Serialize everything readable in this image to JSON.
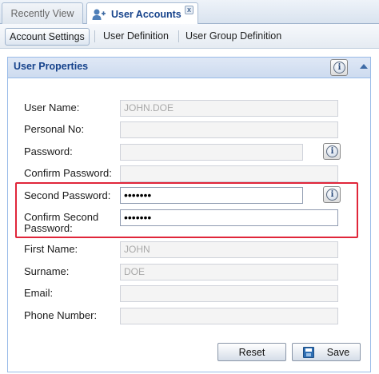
{
  "tabs": {
    "recent_label": "Recently View",
    "accounts_label": "User Accounts",
    "close_glyph": "x"
  },
  "subtabs": {
    "account_settings": "Account Settings",
    "user_definition": "User Definition",
    "user_group_definition": "User Group Definition"
  },
  "panel": {
    "title": "User Properties",
    "info_glyph": "i"
  },
  "form": {
    "user_name": {
      "label": "User Name:",
      "value": "JOHN.DOE"
    },
    "personal_no": {
      "label": "Personal No:",
      "value": ""
    },
    "password": {
      "label": "Password:",
      "value": ""
    },
    "confirm_password": {
      "label": "Confirm Password:",
      "value": ""
    },
    "second_password": {
      "label": "Second Password:",
      "value": "•••••••"
    },
    "confirm_second_password": {
      "label_line1": "Confirm Second",
      "label_line2": "Password:",
      "value": "•••••••"
    },
    "first_name": {
      "label": "First Name:",
      "value": "JOHN"
    },
    "surname": {
      "label": "Surname:",
      "value": "DOE"
    },
    "email": {
      "label": "Email:",
      "value": ""
    },
    "phone_number": {
      "label": "Phone Number:",
      "value": ""
    }
  },
  "buttons": {
    "reset_label": "Reset",
    "save_label": "Save"
  },
  "colors": {
    "highlight": "#e0263a",
    "header_text": "#15428b",
    "panel_border": "#99bbe8"
  }
}
